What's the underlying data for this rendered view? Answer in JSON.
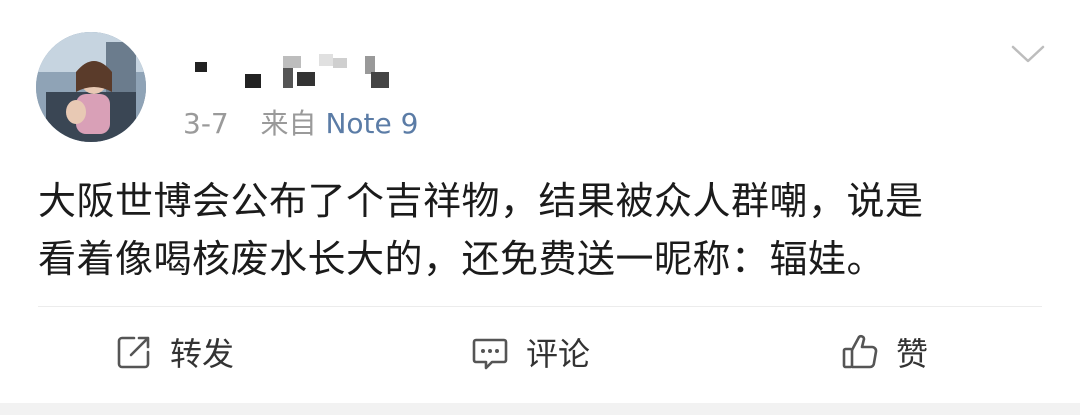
{
  "post": {
    "avatar_icon": "user-avatar-photo",
    "username_display": "pixelated",
    "date": "3-7",
    "source_prefix": "来自",
    "source_device": "Note 9",
    "menu_icon": "chevron-down-icon",
    "content_lines": [
      "大阪世博会公布了个吉祥物，结果被众人群嘲，说是",
      "看着像喝核废水长大的，还免费送一昵称：辐娃。"
    ]
  },
  "actions": {
    "repost": {
      "label": "转发",
      "icon": "share-icon"
    },
    "comment": {
      "label": "评论",
      "icon": "comment-icon"
    },
    "like": {
      "label": "赞",
      "icon": "thumbs-up-icon"
    }
  },
  "colors": {
    "source_link": "#5b7ca6",
    "meta_text": "#9a9a9a",
    "body_text": "#1b1b1b"
  }
}
